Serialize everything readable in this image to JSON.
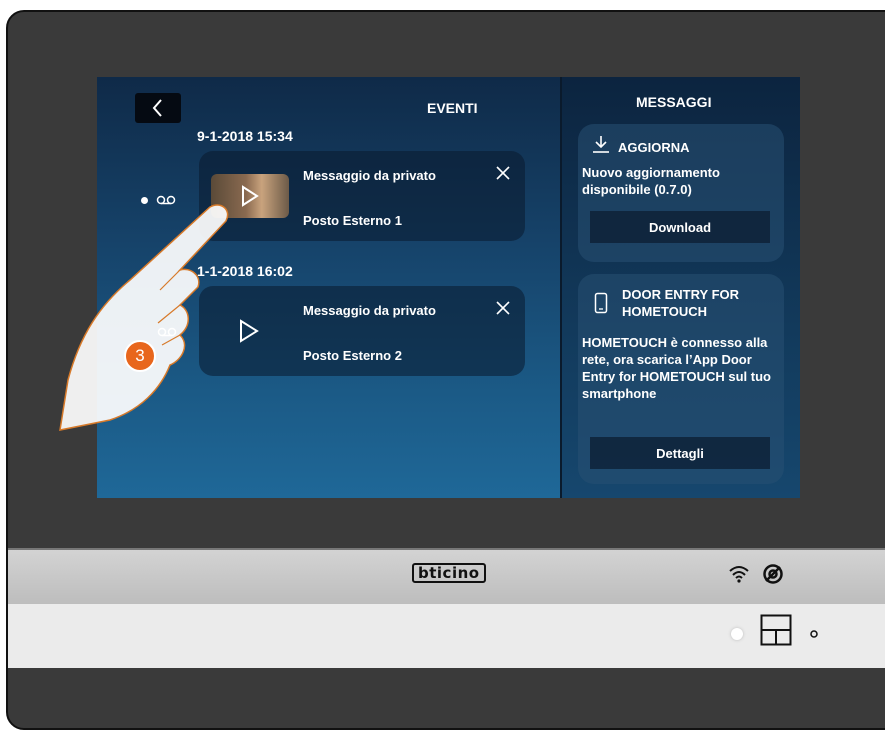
{
  "events": {
    "title": "EVENTI",
    "back_icon": "chevron-left-icon",
    "items": [
      {
        "date": "9-1-2018  15:34",
        "subject": "Messaggio da privato",
        "source": "Posto Esterno 1",
        "has_thumbnail": true
      },
      {
        "date": "1-1-2018  16:02",
        "subject": "Messaggio da privato",
        "source": "Posto Esterno 2",
        "has_thumbnail": false
      }
    ]
  },
  "messages": {
    "title": "MESSAGGI",
    "cards": [
      {
        "icon": "download-icon",
        "heading": "AGGIORNA",
        "body": "Nuovo aggiornamento disponibile (0.7.0)",
        "button": "Download"
      },
      {
        "icon": "smartphone-icon",
        "heading": "DOOR ENTRY FOR HOMETOUCH",
        "body": "HOMETOUCH è connesso alla rete, ora scarica l’App Door Entry for HOMETOUCH sul tuo smartphone",
        "button": "Dettagli"
      }
    ]
  },
  "device": {
    "brand": "bticino",
    "step_badge": "3",
    "icons": [
      "wifi-icon",
      "at-icon",
      "home-button-icon"
    ]
  },
  "colors": {
    "accent_badge": "#e8661c",
    "screen_bg": "#16436a"
  }
}
